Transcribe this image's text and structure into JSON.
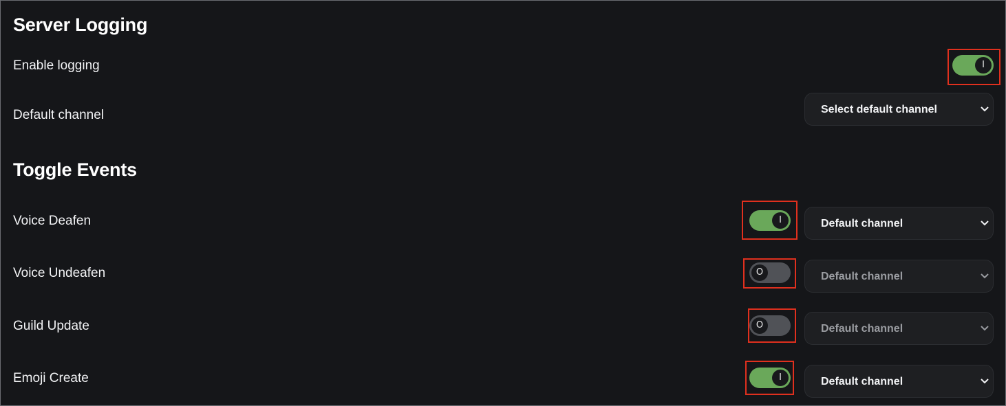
{
  "server_logging": {
    "heading": "Server Logging",
    "enable_logging": {
      "label": "Enable logging",
      "on": true,
      "knob_glyph": "I"
    },
    "default_channel": {
      "label": "Default channel",
      "select_value": "Select default channel"
    }
  },
  "toggle_events": {
    "heading": "Toggle Events",
    "events": [
      {
        "label": "Voice Deafen",
        "on": true,
        "knob_glyph": "I",
        "channel": "Default channel"
      },
      {
        "label": "Voice Undeafen",
        "on": false,
        "knob_glyph": "O",
        "channel": "Default channel"
      },
      {
        "label": "Guild Update",
        "on": false,
        "knob_glyph": "O",
        "channel": "Default channel"
      },
      {
        "label": "Emoji Create",
        "on": true,
        "knob_glyph": "I",
        "channel": "Default channel"
      }
    ]
  },
  "colors": {
    "background": "#151619",
    "toggle_on": "#6aa85a",
    "toggle_off": "#505257",
    "select_bg": "#1e1f22",
    "highlight": "#e0301e"
  }
}
